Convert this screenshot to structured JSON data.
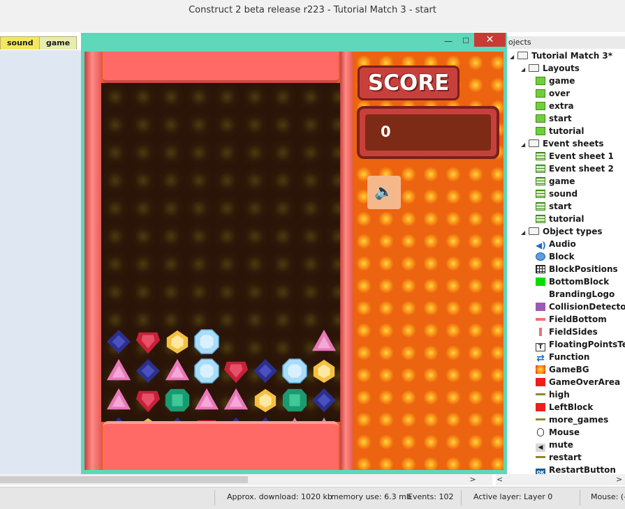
{
  "window": {
    "title": "Construct 2 beta release r223 - Tutorial Match 3 - start"
  },
  "tabs": [
    {
      "label": "sound"
    },
    {
      "label": "game"
    }
  ],
  "preview": {
    "controls": {
      "minimize": "—",
      "maximize": "☐",
      "close": "✕"
    },
    "score_title": "SCORE",
    "score_value": "0",
    "mute_icon": "🔈",
    "gem_colors": {
      "blue": "#2c2f8c",
      "red": "#c8203a",
      "yellow": "#f5c040",
      "lightblue": "#a8dcf8",
      "pink": "#e878b8",
      "green": "#1a9a70"
    },
    "gems": [
      [
        "blue",
        "red",
        "yellow",
        "lightblue",
        "",
        "",
        "",
        "pink"
      ],
      [
        "pink",
        "blue",
        "pink",
        "lightblue",
        "red",
        "blue",
        "lightblue",
        "yellow"
      ],
      [
        "pink",
        "red",
        "green",
        "pink",
        "pink",
        "yellow",
        "green",
        "blue"
      ],
      [
        "blue",
        "yellow",
        "blue",
        "red",
        "blue",
        "blue",
        "pink",
        "pink"
      ]
    ]
  },
  "project_panel": {
    "header": "ojects",
    "project": "Tutorial Match 3*",
    "layouts_folder": "Layouts",
    "layouts": [
      "game",
      "over",
      "extra",
      "start",
      "tutorial"
    ],
    "events_folder": "Event sheets",
    "event_sheets": [
      "Event sheet 1",
      "Event sheet 2",
      "game",
      "sound",
      "start",
      "tutorial"
    ],
    "objects_folder": "Object types",
    "object_types": [
      {
        "name": "Audio",
        "icon": "audio-icon"
      },
      {
        "name": "Block",
        "icon": "block-icon"
      },
      {
        "name": "BlockPositions",
        "icon": "grid-icon"
      },
      {
        "name": "BottomBlock",
        "icon": "green-square-icon"
      },
      {
        "name": "BrandingLogo",
        "icon": "blank-icon"
      },
      {
        "name": "CollisionDetector",
        "icon": "purple-square-icon"
      },
      {
        "name": "FieldBottom",
        "icon": "pink-bar-icon"
      },
      {
        "name": "FieldSides",
        "icon": "pink-side-icon"
      },
      {
        "name": "FloatingPointsText",
        "icon": "text-icon"
      },
      {
        "name": "Function",
        "icon": "function-icon"
      },
      {
        "name": "GameBG",
        "icon": "gamebg-icon"
      },
      {
        "name": "GameOverArea",
        "icon": "red-square-icon"
      },
      {
        "name": "high",
        "icon": "line-icon"
      },
      {
        "name": "LeftBlock",
        "icon": "red-square-icon"
      },
      {
        "name": "more_games",
        "icon": "line-icon"
      },
      {
        "name": "Mouse",
        "icon": "mouse-icon"
      },
      {
        "name": "mute",
        "icon": "mute-icon"
      },
      {
        "name": "restart",
        "icon": "line-icon"
      },
      {
        "name": "RestartButton",
        "icon": "ok-icon"
      }
    ]
  },
  "status": {
    "download": "Approx. download: 1020 kb",
    "memory": "memory use: 6.3 mb",
    "events": "Events: 102",
    "layer": "Active layer: Layer 0",
    "mouse": "Mouse: (-"
  }
}
